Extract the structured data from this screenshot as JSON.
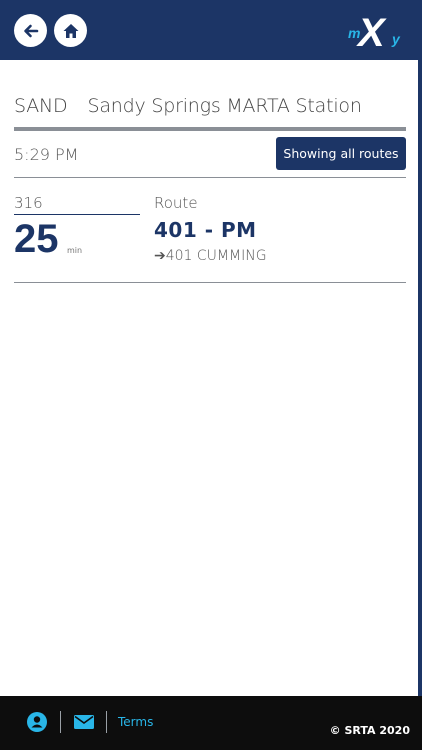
{
  "header": {
    "back_icon": "arrow-left-icon",
    "home_icon": "home-icon",
    "logo_text_small": "m",
    "logo_text_big": "X",
    "logo_text_tail": "y"
  },
  "stop": {
    "code": "SAND",
    "name": "Sandy Springs MARTA Station"
  },
  "status": {
    "time": "5:29 PM",
    "filter_button": "Showing all routes"
  },
  "arrivals": [
    {
      "bus_id": "316",
      "minutes": "25",
      "minutes_unit": "min",
      "route_label": "Route",
      "route_name": "401 - PM",
      "direction_arrow": "➔",
      "destination": "401 CUMMING"
    }
  ],
  "footer": {
    "profile_icon": "user-icon",
    "mail_icon": "mail-icon",
    "terms": "Terms",
    "copyright": "© SRTA 2020"
  },
  "colors": {
    "primary": "#1c3566",
    "accent": "#29b6e8",
    "footer_bg": "#0d0d0d"
  }
}
